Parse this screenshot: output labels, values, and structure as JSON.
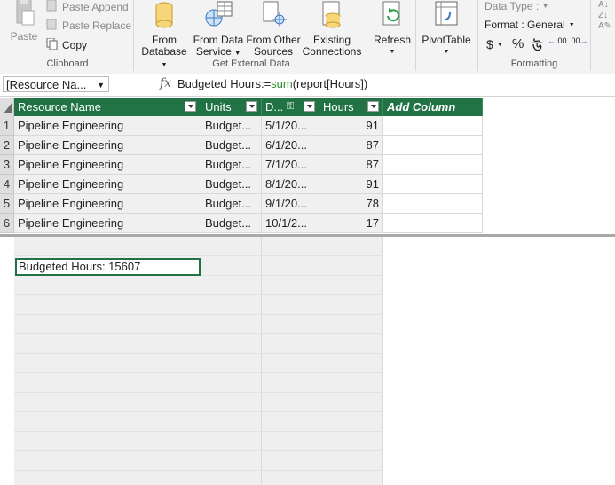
{
  "ribbon": {
    "clipboard": {
      "paste": "Paste",
      "paste_append": "Paste Append",
      "paste_replace": "Paste Replace",
      "copy": "Copy",
      "label": "Clipboard"
    },
    "external": {
      "from_database_1": "From",
      "from_database_2": "Database",
      "from_data_service_1": "From Data",
      "from_data_service_2": "Service",
      "from_other_1": "From Other",
      "from_other_2": "Sources",
      "existing_1": "Existing",
      "existing_2": "Connections",
      "label": "Get External Data"
    },
    "refresh": "Refresh",
    "pivottable": "PivotTable",
    "formatting": {
      "data_type": "Data Type :",
      "format": "Format : General",
      "currency": "$",
      "percent": "%",
      "comma": "উ",
      "inc_decimal": ".00",
      "dec_decimal": ".00",
      "label": "Formatting"
    }
  },
  "formula_bar": {
    "name_box": "[Resource Na...",
    "fx": "fx",
    "formula_pre": "Budgeted Hours:=",
    "formula_fn": "sum",
    "formula_post": "(report[Hours])"
  },
  "table": {
    "columns": [
      "Resource Name",
      "Units",
      "D...",
      "Hours",
      "Add Column"
    ],
    "rows": [
      {
        "num": "1",
        "resource": "Pipeline Engineering",
        "units": "Budget...",
        "date": "5/1/20...",
        "hours": "91"
      },
      {
        "num": "2",
        "resource": "Pipeline Engineering",
        "units": "Budget...",
        "date": "6/1/20...",
        "hours": "87"
      },
      {
        "num": "3",
        "resource": "Pipeline Engineering",
        "units": "Budget...",
        "date": "7/1/20...",
        "hours": "87"
      },
      {
        "num": "4",
        "resource": "Pipeline Engineering",
        "units": "Budget...",
        "date": "8/1/20...",
        "hours": "91"
      },
      {
        "num": "5",
        "resource": "Pipeline Engineering",
        "units": "Budget...",
        "date": "9/1/20...",
        "hours": "78"
      },
      {
        "num": "6",
        "resource": "Pipeline Engineering",
        "units": "Budget...",
        "date": "10/1/2...",
        "hours": "17"
      }
    ]
  },
  "calc_area": {
    "measure": "Budgeted Hours: 15607"
  },
  "colors": {
    "header_green": "#217346",
    "selected_border": "#217346",
    "function_green": "#2e8b2e"
  }
}
